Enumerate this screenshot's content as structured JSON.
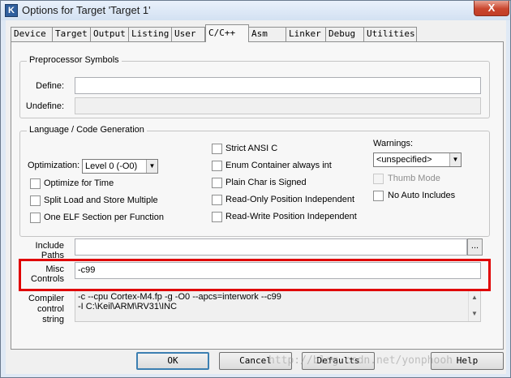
{
  "window": {
    "title": "Options for Target 'Target 1'",
    "close_label": "X"
  },
  "tabs": [
    {
      "label": "Device"
    },
    {
      "label": "Target"
    },
    {
      "label": "Output"
    },
    {
      "label": "Listing"
    },
    {
      "label": "User"
    },
    {
      "label": "C/C++",
      "active": true
    },
    {
      "label": "Asm"
    },
    {
      "label": "Linker"
    },
    {
      "label": "Debug"
    },
    {
      "label": "Utilities"
    }
  ],
  "preprocessor": {
    "group_label": "Preprocessor Symbols",
    "define_label": "Define:",
    "define_value": "",
    "undefine_label": "Undefine:",
    "undefine_value": ""
  },
  "language": {
    "group_label": "Language / Code Generation",
    "optimization_label": "Optimization:",
    "optimization_value": "Level 0 (-O0)",
    "checkboxes_left": [
      {
        "label": "Optimize for Time",
        "checked": false
      },
      {
        "label": "Split Load and Store Multiple",
        "checked": false
      },
      {
        "label": "One ELF Section per Function",
        "checked": false
      }
    ],
    "checkboxes_middle": [
      {
        "label": "Strict ANSI C",
        "checked": false
      },
      {
        "label": "Enum Container always int",
        "checked": false
      },
      {
        "label": "Plain Char is Signed",
        "checked": false
      },
      {
        "label": "Read-Only Position Independent",
        "checked": false
      },
      {
        "label": "Read-Write Position Independent",
        "checked": false
      }
    ],
    "warnings_label": "Warnings:",
    "warnings_value": "<unspecified>",
    "thumb_mode_label": "Thumb Mode",
    "no_auto_includes_label": "No Auto Includes"
  },
  "include_paths": {
    "label_line1": "Include",
    "label_line2": "Paths",
    "value": "",
    "browse_label": "..."
  },
  "misc_controls": {
    "label_line1": "Misc",
    "label_line2": "Controls",
    "value": "-c99"
  },
  "compiler_control": {
    "label_line1": "Compiler",
    "label_line2": "control",
    "label_line3": "string",
    "line1": "-c --cpu Cortex-M4.fp -g -O0 --apcs=interwork --c99",
    "line2": "-I C:\\Keil\\ARM\\RV31\\INC"
  },
  "buttons": {
    "ok": "OK",
    "cancel": "Cancel",
    "defaults": "Defaults",
    "help": "Help"
  },
  "watermark": "http://blog.csdn.net/yonphooh",
  "colors": {
    "highlight": "#e00000"
  }
}
